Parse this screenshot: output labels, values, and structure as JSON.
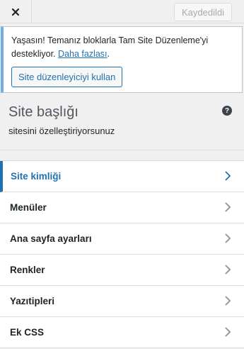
{
  "header": {
    "close_icon": "close-icon",
    "save_label": "Kaydedildi"
  },
  "notice": {
    "text": "Yaşasın! Temanız bloklarla Tam Site Düzenleme'yi destekliyor.",
    "link_label": "Daha fazlası",
    "link_suffix": ".",
    "button_label": "Site düzenleyiciyi kullan",
    "accent_color": "#72aee6"
  },
  "panel": {
    "title": "Site başlığı",
    "subtitle": "sitesini özelleştiriyorsunuz",
    "help_icon": "help-icon",
    "help_glyph": "?"
  },
  "menu": {
    "items": [
      {
        "label": "Site kimliği",
        "active": true
      },
      {
        "label": "Menüler",
        "active": false
      },
      {
        "label": "Ana sayfa ayarları",
        "active": false
      },
      {
        "label": "Renkler",
        "active": false
      },
      {
        "label": "Yazıtipleri",
        "active": false
      },
      {
        "label": "Ek CSS",
        "active": false
      }
    ],
    "chevron_icon": "chevron-right-icon",
    "active_color": "#2271b1"
  }
}
